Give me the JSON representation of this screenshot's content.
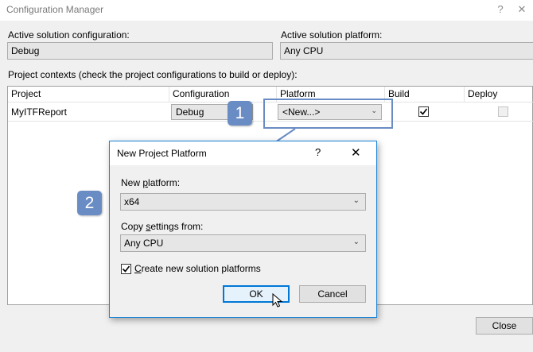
{
  "window": {
    "title": "Configuration Manager",
    "help_label": "?",
    "close_label": "✕"
  },
  "active_config": {
    "label": "Active solution configuration:",
    "value": "Debug"
  },
  "active_platform": {
    "label": "Active solution platform:",
    "value": "Any CPU"
  },
  "contexts_label": "Project contexts (check the project configurations to build or deploy):",
  "grid": {
    "headers": {
      "project": "Project",
      "configuration": "Configuration",
      "platform": "Platform",
      "build": "Build",
      "deploy": "Deploy"
    },
    "rows": [
      {
        "project": "MyITFReport",
        "configuration": "Debug",
        "platform": "<New...>",
        "build": true,
        "deploy": false
      }
    ]
  },
  "close_button": "Close",
  "dialog": {
    "title": "New Project Platform",
    "help_label": "?",
    "close_label": "✕",
    "new_platform_label_pre": "New ",
    "new_platform_label_key": "p",
    "new_platform_label_post": "latform:",
    "new_platform_value": "x64",
    "copy_label_pre": "Copy ",
    "copy_label_key": "s",
    "copy_label_post": "ettings from:",
    "copy_value": "Any CPU",
    "create_label_key": "C",
    "create_label_post": "reate new solution platforms",
    "create_checked": true,
    "ok_label": "OK",
    "cancel_label": "Cancel"
  },
  "callouts": {
    "step1": "1",
    "step2": "2",
    "color": "#6a8cc4"
  },
  "colors": {
    "dialog_border": "#1883d7",
    "window_bg": "#f0f0f0"
  }
}
